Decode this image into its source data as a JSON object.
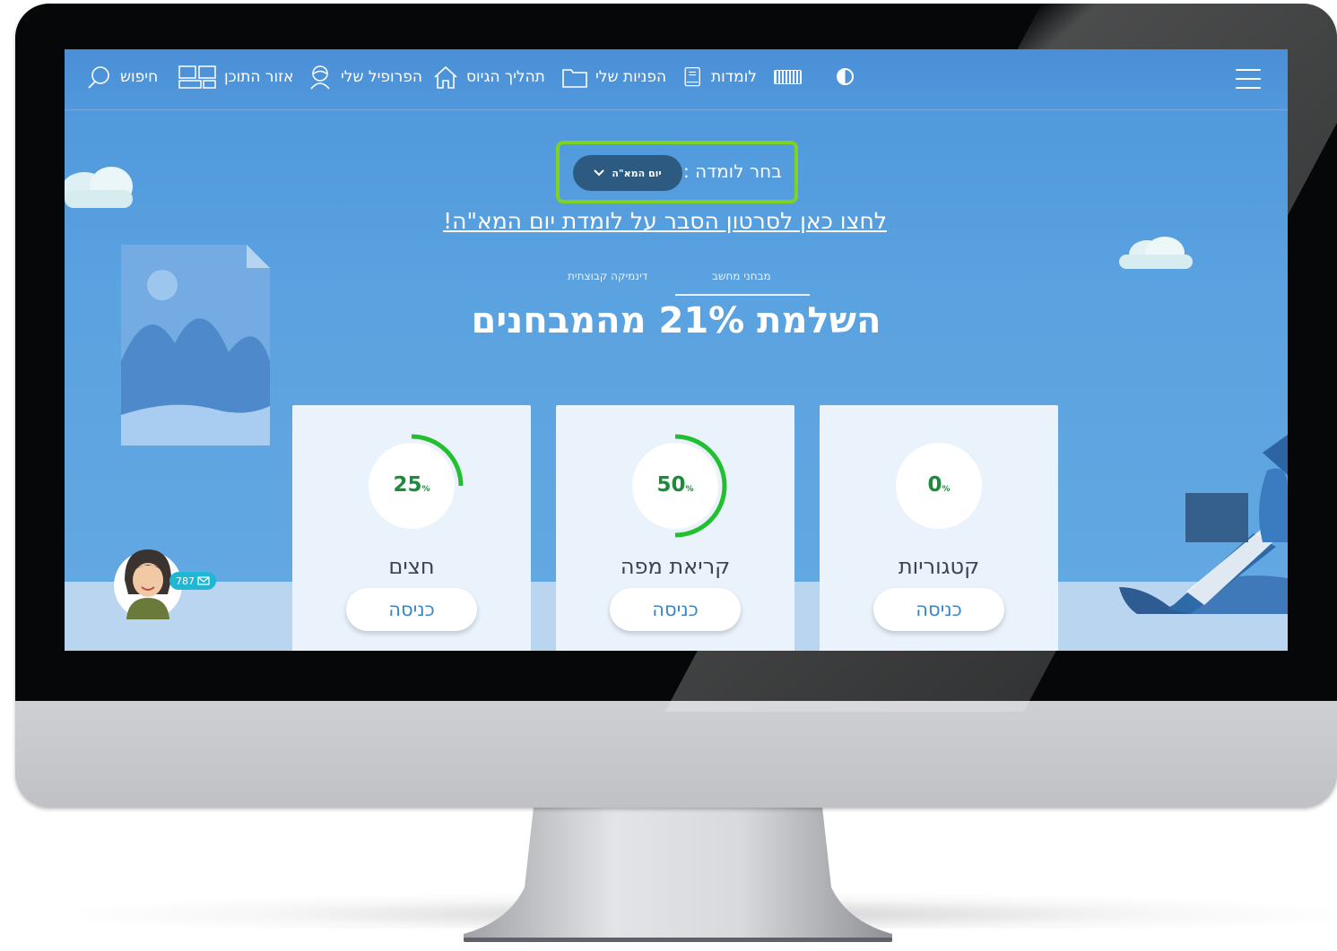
{
  "topbar": {
    "search_label": "חיפוש",
    "content_area_label": "אזור התוכן",
    "profile_label": "הפרופיל שלי",
    "process_label": "תהליך הגיוס",
    "inquiries_label": "הפניות שלי",
    "lomdot_label": "לומדות"
  },
  "selector": {
    "label": "בחר לומדה :",
    "selected": "יום המא\"ה"
  },
  "video_link": "לחצו כאן לסרטון הסבר על לומדת יום המא\"ה!",
  "tabs": [
    {
      "label": "מבחני מחשב",
      "active": true
    },
    {
      "label": "דינמיקה קבוצתית",
      "active": false
    }
  ],
  "headline": "השלמת 21% מהמבחנים",
  "cards": [
    {
      "title": "חצים",
      "percent": 25,
      "percent_sign": "%",
      "button": "כניסה"
    },
    {
      "title": "קריאת מפה",
      "percent": 50,
      "percent_sign": "%",
      "button": "כניסה"
    },
    {
      "title": "קטגוריות",
      "percent": 0,
      "percent_sign": "%",
      "button": "כניסה"
    }
  ],
  "messages_badge": "787",
  "colors": {
    "accent_green": "#7ed321",
    "progress_green": "#22c02f",
    "screen_blue": "#5aa2e0"
  },
  "icons": [
    "search-icon",
    "content-area-icon",
    "profile-icon",
    "home-icon",
    "folder-icon",
    "document-icon",
    "keyboard-icon",
    "contrast-icon",
    "menu-icon",
    "mail-icon",
    "chevron-down-icon"
  ]
}
